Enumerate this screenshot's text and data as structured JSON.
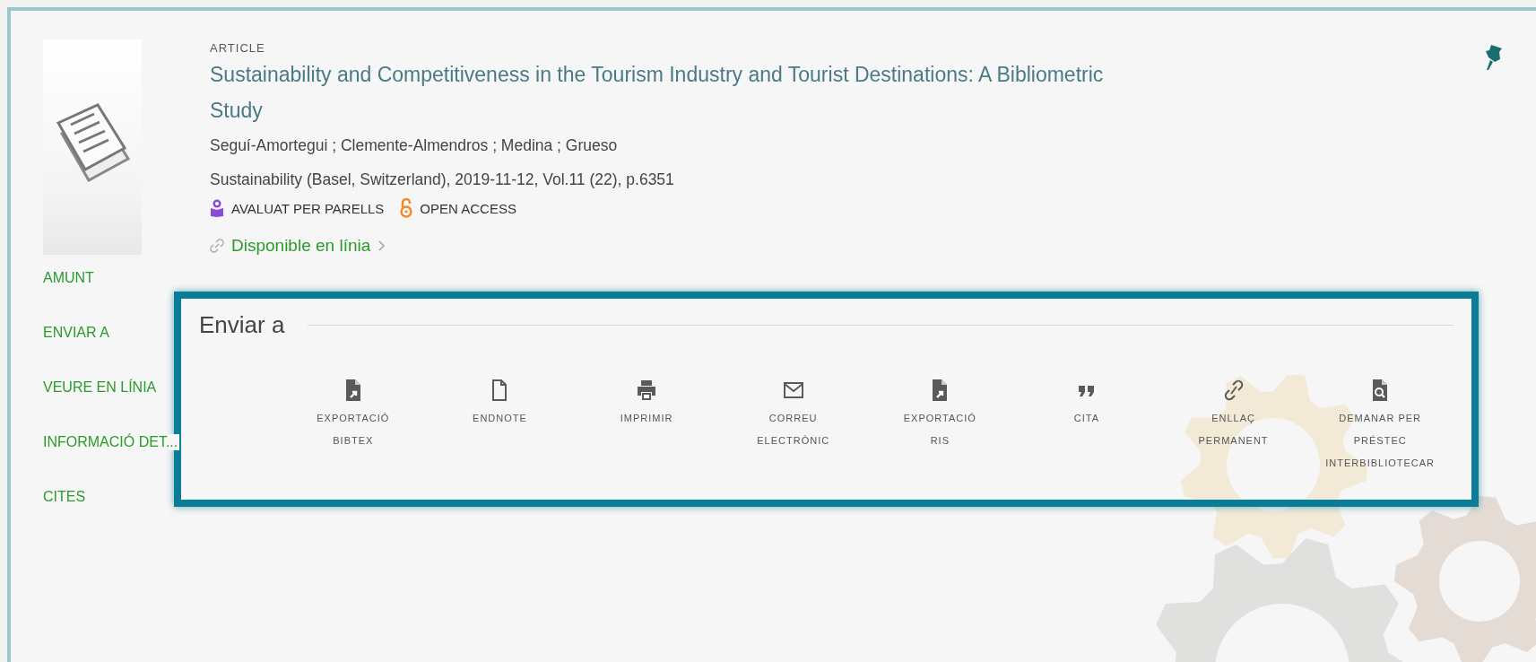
{
  "record": {
    "type_label": "ARTICLE",
    "title": "Sustainability and Competitiveness in the Tourism Industry and Tourist Destinations: A Bibliometric Study",
    "authors": "Seguí-Amortegui ; Clemente-Almendros ; Medina ; Grueso",
    "source": "Sustainability (Basel, Switzerland), 2019-11-12, Vol.11 (22), p.6351",
    "badges": [
      {
        "kind": "peer-reviewed",
        "label": "AVALUAT PER PARELLS"
      },
      {
        "kind": "open-access",
        "label": "OPEN ACCESS"
      }
    ],
    "availability": "Disponible en línia"
  },
  "section_nav": [
    {
      "label": "AMUNT"
    },
    {
      "label": "ENVIAR A"
    },
    {
      "label": "VEURE EN LÍNIA"
    },
    {
      "label": "INFORMACIÓ DET..."
    },
    {
      "label": "CITES"
    }
  ],
  "send_to": {
    "title": "Enviar a",
    "actions": [
      {
        "kind": "file-export",
        "label": "EXPORTACIÓ\nBIBTEX"
      },
      {
        "kind": "document",
        "label": "ENDNOTE"
      },
      {
        "kind": "print",
        "label": "IMPRIMIR"
      },
      {
        "kind": "email",
        "label": "CORREU\nELECTRÒNIC"
      },
      {
        "kind": "file-export",
        "label": "EXPORTACIÓ\nRIS"
      },
      {
        "kind": "quote",
        "label": "CITA"
      },
      {
        "kind": "link",
        "label": "ENLLAÇ\nPERMANENT"
      },
      {
        "kind": "file-search",
        "label": "DEMANAR PER\nPRÉSTEC\nINTERBIBLIOTECAR"
      }
    ]
  }
}
